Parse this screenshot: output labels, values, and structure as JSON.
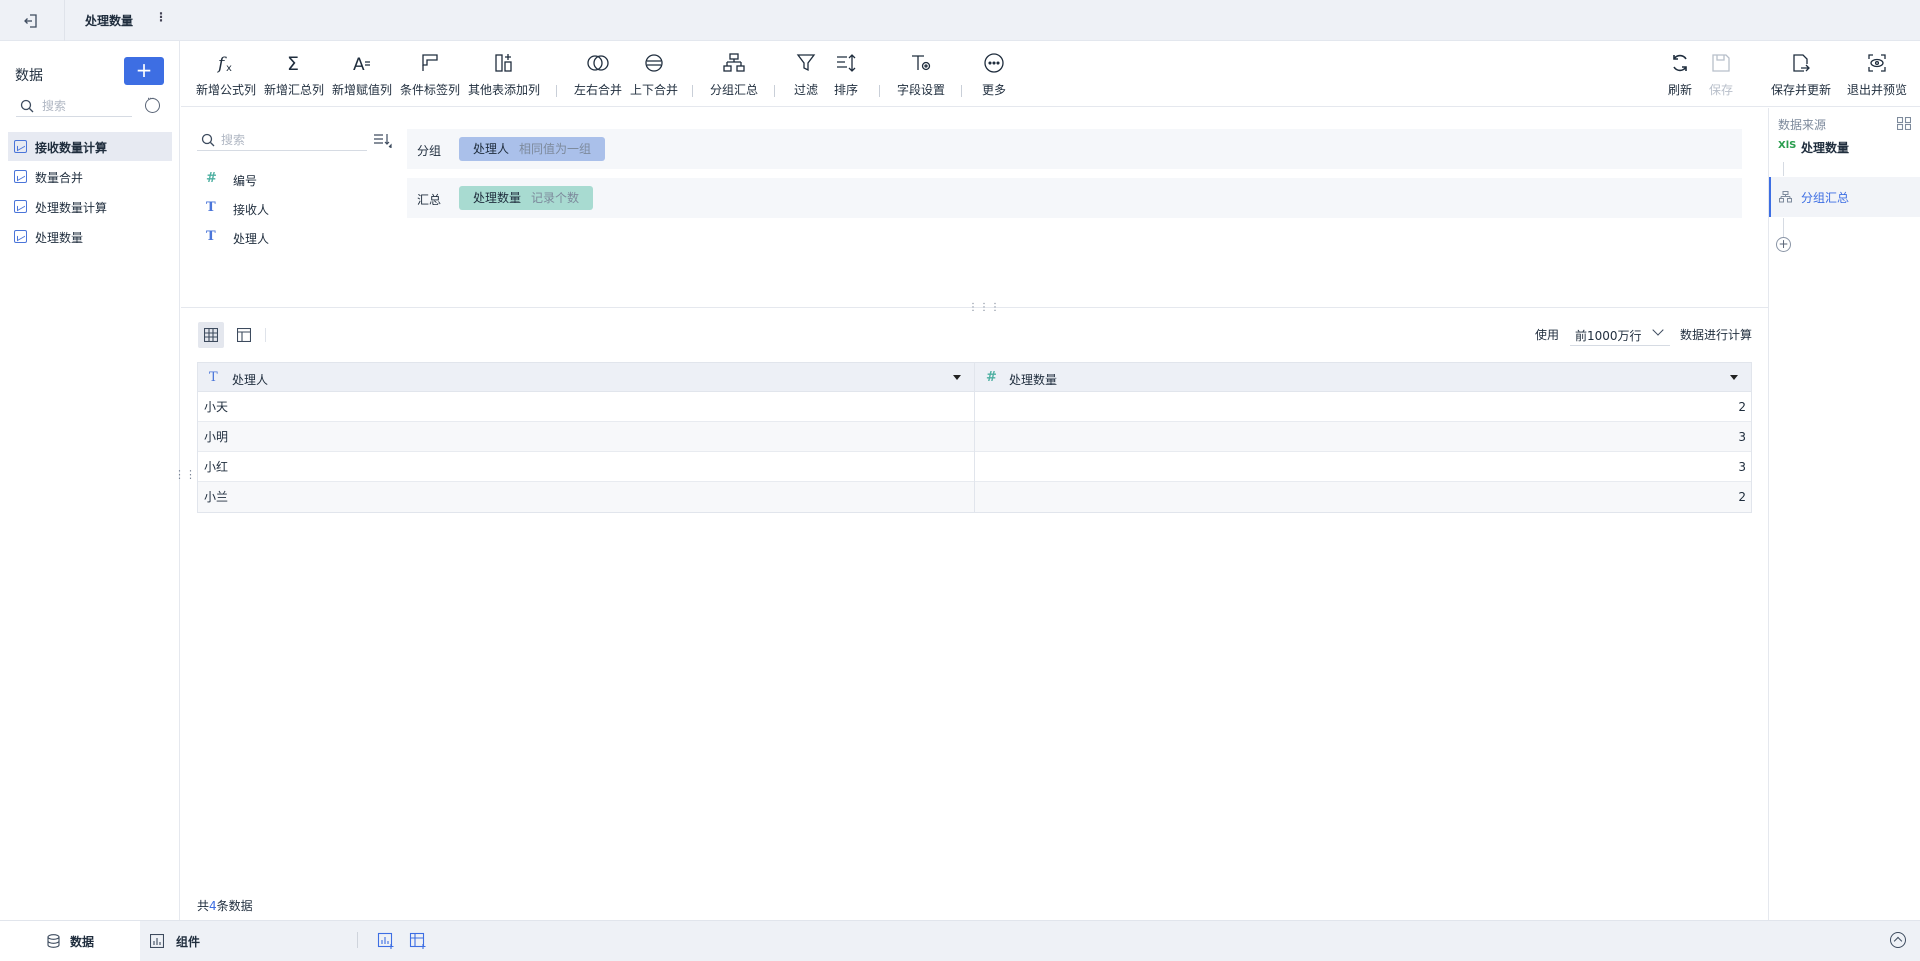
{
  "topbar": {
    "title": "处理数量"
  },
  "left_panel": {
    "header": "数据",
    "add_label": "+",
    "search_placeholder": "搜索",
    "tables": [
      {
        "label": "接收数量计算",
        "active": true
      },
      {
        "label": "数量合并",
        "active": false
      },
      {
        "label": "处理数量计算",
        "active": false
      },
      {
        "label": "处理数量",
        "active": false
      }
    ]
  },
  "toolbar": {
    "items": [
      {
        "label": "新增公式列",
        "icon": "formula-icon"
      },
      {
        "label": "新增汇总列",
        "icon": "sigma-icon"
      },
      {
        "label": "新增赋值列",
        "icon": "assign-icon"
      },
      {
        "label": "条件标签列",
        "icon": "condition-tag-icon"
      },
      {
        "label": "其他表添加列",
        "icon": "add-column-icon"
      },
      {
        "label": "左右合并",
        "icon": "horizontal-merge-icon"
      },
      {
        "label": "上下合并",
        "icon": "vertical-merge-icon"
      },
      {
        "label": "分组汇总",
        "icon": "group-summary-icon"
      },
      {
        "label": "过滤",
        "icon": "filter-icon"
      },
      {
        "label": "排序",
        "icon": "sort-icon"
      },
      {
        "label": "字段设置",
        "icon": "field-settings-icon"
      },
      {
        "label": "更多",
        "icon": "more-icon"
      }
    ],
    "right_items": [
      {
        "label": "刷新",
        "icon": "refresh-icon",
        "disabled": false
      },
      {
        "label": "保存",
        "icon": "save-icon",
        "disabled": true
      },
      {
        "label": "保存并更新",
        "icon": "save-update-icon",
        "disabled": false
      },
      {
        "label": "退出并预览",
        "icon": "exit-preview-icon",
        "disabled": false
      }
    ]
  },
  "fields": {
    "search_placeholder": "搜索",
    "items": [
      {
        "label": "编号",
        "type": "number",
        "type_glyph": "#"
      },
      {
        "label": "接收人",
        "type": "text",
        "type_glyph": "T"
      },
      {
        "label": "处理人",
        "type": "text",
        "type_glyph": "T"
      }
    ]
  },
  "config": {
    "group": {
      "caption": "分组",
      "field": "处理人",
      "mode": "相同值为一组",
      "color": "#aac0ea"
    },
    "summary": {
      "caption": "汇总",
      "field": "处理数量",
      "mode": "记录个数",
      "color": "#a8dbd1"
    }
  },
  "preview": {
    "row_limit_prefix": "使用",
    "row_limit_value": "前1000万行",
    "row_limit_suffix": "数据进行计算",
    "columns": [
      {
        "label": "处理人",
        "type": "text",
        "type_glyph": "T"
      },
      {
        "label": "处理数量",
        "type": "number",
        "type_glyph": "#"
      }
    ],
    "rows": [
      [
        "小天",
        "2"
      ],
      [
        "小明",
        "3"
      ],
      [
        "小红",
        "3"
      ],
      [
        "小兰",
        "2"
      ]
    ],
    "footer_prefix": "共",
    "footer_count": "4",
    "footer_suffix": "条数据"
  },
  "right_panel": {
    "caption": "数据来源",
    "source_badge": "XlS",
    "source_label": "处理数量",
    "step_label": "分组汇总",
    "add_label": "+"
  },
  "bottombar": {
    "tabs": [
      {
        "label": "数据",
        "icon": "database-icon",
        "active": true
      },
      {
        "label": "组件",
        "icon": "chart-icon",
        "active": false
      }
    ]
  },
  "colors": {
    "accent": "#3d6ee3",
    "text_type": "#4a75d9",
    "number_type": "#4fb0a2"
  }
}
